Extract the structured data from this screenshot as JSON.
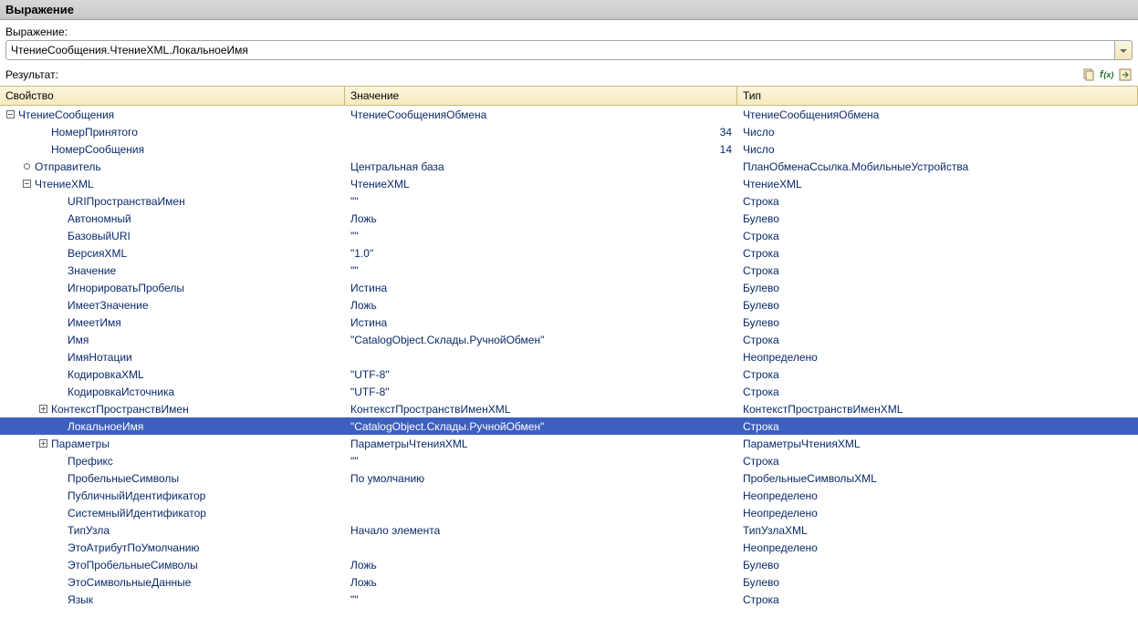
{
  "title": "Выражение",
  "expression_label": "Выражение:",
  "expression_value": "ЧтениеСообщения.ЧтениеXML.ЛокальноеИмя",
  "result_label": "Результат:",
  "columns": {
    "property": "Свойство",
    "value": "Значение",
    "type": "Тип"
  },
  "rows": [
    {
      "indent": 0,
      "expander": "minus",
      "prop": "ЧтениеСообщения",
      "val": "ЧтениеСообщенияОбмена",
      "type": "ЧтениеСообщенияОбмена"
    },
    {
      "indent": 2,
      "expander": "none",
      "prop": "НомерПринятого",
      "val": "34",
      "type": "Число",
      "numeric": true
    },
    {
      "indent": 2,
      "expander": "none",
      "prop": "НомерСообщения",
      "val": "14",
      "type": "Число",
      "numeric": true
    },
    {
      "indent": 1,
      "expander": "dot",
      "prop": "Отправитель",
      "val": "Центральная база",
      "type": "ПланОбменаСсылка.МобильныеУстройства"
    },
    {
      "indent": 1,
      "expander": "minus",
      "prop": "ЧтениеXML",
      "val": "ЧтениеXML",
      "type": "ЧтениеXML"
    },
    {
      "indent": 3,
      "expander": "none",
      "prop": "URIПространстваИмен",
      "val": "\"\"",
      "type": "Строка"
    },
    {
      "indent": 3,
      "expander": "none",
      "prop": "Автономный",
      "val": "Ложь",
      "type": "Булево"
    },
    {
      "indent": 3,
      "expander": "none",
      "prop": "БазовыйURI",
      "val": "\"\"",
      "type": "Строка"
    },
    {
      "indent": 3,
      "expander": "none",
      "prop": "ВерсияXML",
      "val": "\"1.0\"",
      "type": "Строка"
    },
    {
      "indent": 3,
      "expander": "none",
      "prop": "Значение",
      "val": "\"\"",
      "type": "Строка"
    },
    {
      "indent": 3,
      "expander": "none",
      "prop": "ИгнорироватьПробелы",
      "val": "Истина",
      "type": "Булево"
    },
    {
      "indent": 3,
      "expander": "none",
      "prop": "ИмеетЗначение",
      "val": "Ложь",
      "type": "Булево"
    },
    {
      "indent": 3,
      "expander": "none",
      "prop": "ИмеетИмя",
      "val": "Истина",
      "type": "Булево"
    },
    {
      "indent": 3,
      "expander": "none",
      "prop": "Имя",
      "val": "\"CatalogObject.Склады.РучнойОбмен\"",
      "type": "Строка"
    },
    {
      "indent": 3,
      "expander": "none",
      "prop": "ИмяНотации",
      "val": "",
      "type": "Неопределено"
    },
    {
      "indent": 3,
      "expander": "none",
      "prop": "КодировкаXML",
      "val": "\"UTF-8\"",
      "type": "Строка"
    },
    {
      "indent": 3,
      "expander": "none",
      "prop": "КодировкаИсточника",
      "val": "\"UTF-8\"",
      "type": "Строка"
    },
    {
      "indent": 2,
      "expander": "plus",
      "prop": "КонтекстПространствИмен",
      "val": "КонтекстПространствИменXML",
      "type": "КонтекстПространствИменXML"
    },
    {
      "indent": 3,
      "expander": "none",
      "prop": "ЛокальноеИмя",
      "val": "\"CatalogObject.Склады.РучнойОбмен\"",
      "type": "Строка",
      "selected": true
    },
    {
      "indent": 2,
      "expander": "plus",
      "prop": "Параметры",
      "val": "ПараметрыЧтенияXML",
      "type": "ПараметрыЧтенияXML"
    },
    {
      "indent": 3,
      "expander": "none",
      "prop": "Префикс",
      "val": "\"\"",
      "type": "Строка"
    },
    {
      "indent": 3,
      "expander": "none",
      "prop": "ПробельныеСимволы",
      "val": "По умолчанию",
      "type": "ПробельныеСимволыXML"
    },
    {
      "indent": 3,
      "expander": "none",
      "prop": "ПубличныйИдентификатор",
      "val": "",
      "type": "Неопределено"
    },
    {
      "indent": 3,
      "expander": "none",
      "prop": "СистемныйИдентификатор",
      "val": "",
      "type": "Неопределено"
    },
    {
      "indent": 3,
      "expander": "none",
      "prop": "ТипУзла",
      "val": "Начало элемента",
      "type": "ТипУзлаXML"
    },
    {
      "indent": 3,
      "expander": "none",
      "prop": "ЭтоАтрибутПоУмолчанию",
      "val": "",
      "type": "Неопределено"
    },
    {
      "indent": 3,
      "expander": "none",
      "prop": "ЭтоПробельныеСимволы",
      "val": "Ложь",
      "type": "Булево"
    },
    {
      "indent": 3,
      "expander": "none",
      "prop": "ЭтоСимвольныеДанные",
      "val": "Ложь",
      "type": "Булево"
    },
    {
      "indent": 3,
      "expander": "none",
      "prop": "Язык",
      "val": "\"\"",
      "type": "Строка"
    }
  ]
}
